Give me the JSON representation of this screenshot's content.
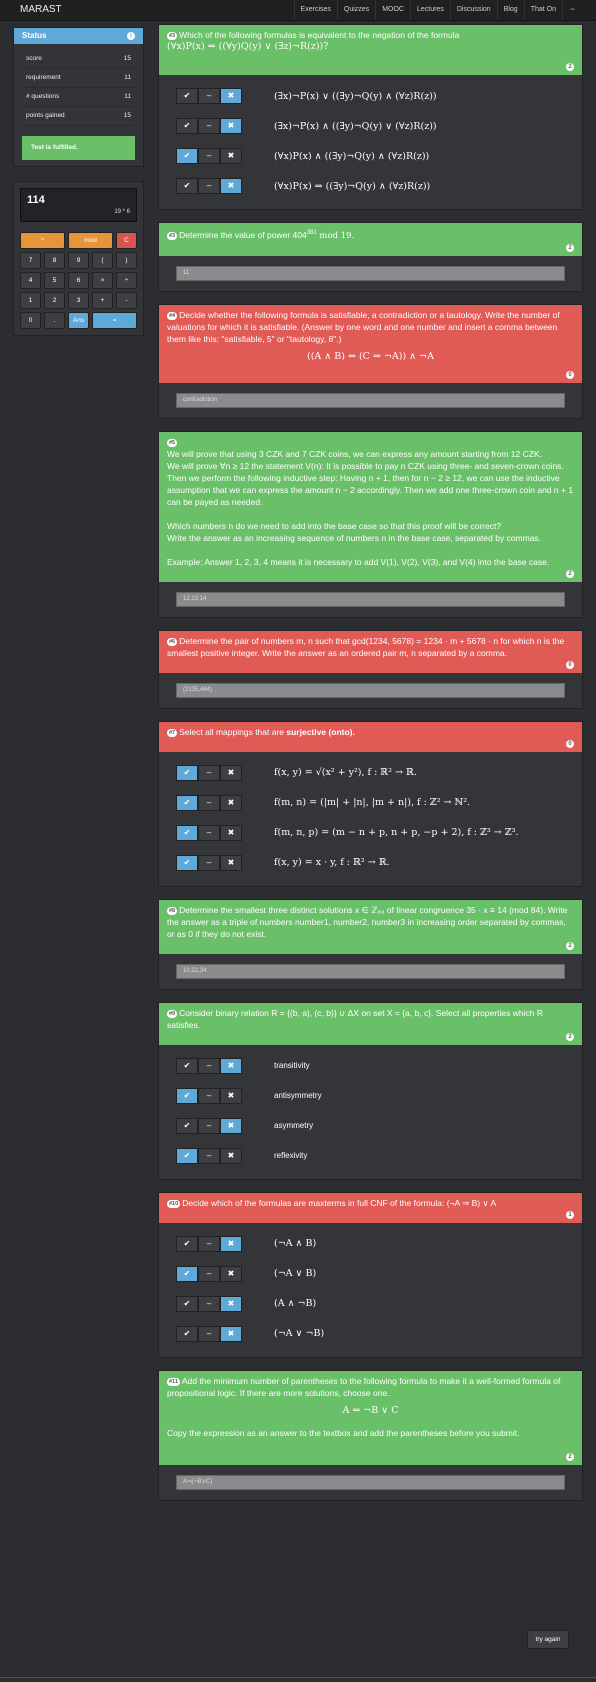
{
  "nav": {
    "brand": "MARAST",
    "items": [
      "Exercises",
      "Quizzes",
      "MOOC",
      "Lectures",
      "Discussion",
      "Blog",
      "That On",
      "⇔"
    ]
  },
  "status": {
    "title": "Status",
    "rows": [
      {
        "label": "score",
        "value": "15"
      },
      {
        "label": "requirement",
        "value": "11"
      },
      {
        "label": "# questions",
        "value": "11"
      },
      {
        "label": "points gained",
        "value": "15"
      }
    ],
    "fulfilled": "Test is fulfilled."
  },
  "calculator": {
    "display": "114",
    "expression": "19 * 6",
    "keys": [
      [
        "^",
        "mod",
        "C"
      ],
      [
        "7",
        "8",
        "9",
        "(",
        ")"
      ],
      [
        "4",
        "5",
        "6",
        "×",
        "÷"
      ],
      [
        "1",
        "2",
        "3",
        "+",
        "-"
      ],
      [
        "0",
        ".",
        "Ans",
        "="
      ]
    ]
  },
  "questions": [
    {
      "num": "#3",
      "color": "green",
      "badge": "2",
      "text": "Which of the following formulas is equivalent to the negation of the formula",
      "formula": "(∀x)P(x) ⇒ ((∀y)Q(y) ∨ (∃z)¬R(z))?",
      "options": [
        {
          "text": "(∃x)¬P(x) ∨ ((∃y)¬Q(y) ∧ (∀z)R(z))",
          "sel": "x"
        },
        {
          "text": "(∃x)¬P(x) ∧ ((∃y)¬Q(y) ∨ (∀z)R(z))",
          "sel": "x"
        },
        {
          "text": "(∀x)P(x) ∧ ((∃y)¬Q(y) ∧ (∀z)R(z))",
          "sel": "check"
        },
        {
          "text": "(∀x)P(x) ⇒ ((∃y)¬Q(y) ∧ (∀z)R(z))",
          "sel": "x"
        }
      ]
    },
    {
      "num": "#3",
      "color": "green",
      "badge": "2",
      "text": "Determine the value of power 404",
      "sup": "381",
      "text2": " mod 19.",
      "answer": "11"
    },
    {
      "num": "#4",
      "color": "red",
      "badge": "0",
      "text": "Decide whether the following formula is satisfiable, a contradiction or a tautology. Write the number of valuations for which it is satisfiable. (Answer by one word and one number and insert a comma between them like this: \"satisfiable, 5\" or \"tautology, 8\".)",
      "formula": "((A ∧ B) ⇔ (C ⇒ ¬A)) ∧ ¬A",
      "answer": "contradiction"
    },
    {
      "num": "#5",
      "color": "green",
      "badge": "2",
      "lines": [
        "We will prove that using 3 CZK and 7 CZK coins, we can express any amount starting from 12 CZK.",
        "We will prove ∀n ≥ 12 the statement V(n): It is possible to pay n CZK using three- and seven-crown coins.",
        "Then we perform the following inductive step: Having n + 1, then for n − 2 ≥ 12, we can use the inductive assumption that we can express the amount n − 2 accordingly. Then we add one three-crown coin and n + 1 can be payed as needed.",
        "",
        "Which numbers n do we need to add into the base case so that this proof will be correct?",
        "Write the answer as an increasing sequence of numbers n in the base case, separated by commas.",
        "",
        "Example: Answer 1, 2, 3, 4 means it is necessary to add V(1), V(2), V(3), and V(4) into the base case."
      ],
      "answer": "12,13,14"
    },
    {
      "num": "#6",
      "color": "red",
      "badge": "0",
      "text": "Determine the pair of numbers m, n such that gcd(1234, 5678) = 1234 · m + 5678 · n for which n is the smallest positive integer. Write the answer as an ordered pair m, n separated by a comma.",
      "answer": "(2135,464)"
    },
    {
      "num": "#7",
      "color": "red",
      "badge": "0",
      "text": "Select all mappings that are ",
      "bold": "surjective (onto).",
      "options": [
        {
          "text": "f(x, y) = √(x² + y²), f : ℝ² → ℝ.",
          "sel": "check"
        },
        {
          "text": "f(m, n) = (|m| + |n|, |m + n|), f : ℤ² → ℕ².",
          "sel": "check"
        },
        {
          "text": "f(m, n, p) = (m − n + p, n + p, −p + 2), f : ℤ³ → ℤ³.",
          "sel": "check"
        },
        {
          "text": "f(x, y) = x · y, f : ℝ² → ℝ.",
          "sel": "check"
        }
      ]
    },
    {
      "num": "#8",
      "color": "green",
      "badge": "2",
      "text": "Determine the smallest three distinct solutions x ∈ ℤ₈₄ of linear congruence 35 · x ≡ 14 (mod 84). Write the answer as a triple of numbers number1, number2, number3 in increasing order separated by commas, or as 0 if they do not exist.",
      "answer": "10,22,34"
    },
    {
      "num": "#9",
      "color": "green",
      "badge": "2",
      "text": "Consider binary relation R = {(b, a), (c, b)} ∪ ΔX on set X = {a, b, c}. Select all properties which R satisfies.",
      "options": [
        {
          "text": "transitivity",
          "sel": "x",
          "sans": true
        },
        {
          "text": "antisymmetry",
          "sel": "check",
          "sans": true
        },
        {
          "text": "asymmetry",
          "sel": "x",
          "sans": true
        },
        {
          "text": "reflexivity",
          "sel": "check",
          "sans": true
        }
      ]
    },
    {
      "num": "#10",
      "color": "red",
      "badge": "1",
      "text": "Decide which of the formulas are maxterms in full CNF of the formula: (¬A ⇒ B) ∨ A",
      "options": [
        {
          "text": "(¬A ∧ B)",
          "sel": "x"
        },
        {
          "text": "(¬A ∨ B)",
          "sel": "check"
        },
        {
          "text": "(A ∧ ¬B)",
          "sel": "x"
        },
        {
          "text": "(¬A ∨ ¬B)",
          "sel": "x"
        }
      ]
    },
    {
      "num": "#11",
      "color": "green",
      "badge": "2",
      "text": "Add the minimum number of parentheses to the following formula to make it a well-formed formula of propositional logic. If there are more solutions, choose one.",
      "formula": "A ⇒ ¬B ∨ C",
      "text2": "Copy the expression as an answer to the textbox and add the parentheses before you submit.",
      "answer": "A⇒(¬B∨C)"
    }
  ],
  "try_again": "try again"
}
